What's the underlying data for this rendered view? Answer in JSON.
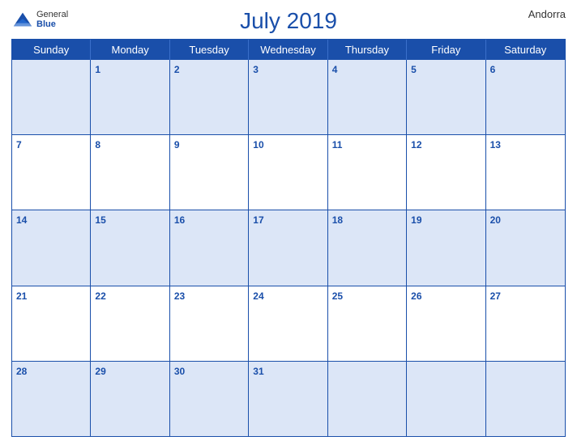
{
  "header": {
    "title": "July 2019",
    "country": "Andorra",
    "logo": {
      "general": "General",
      "blue": "Blue"
    }
  },
  "dayHeaders": [
    "Sunday",
    "Monday",
    "Tuesday",
    "Wednesday",
    "Thursday",
    "Friday",
    "Saturday"
  ],
  "weeks": [
    [
      {
        "num": "",
        "empty": true
      },
      {
        "num": "1"
      },
      {
        "num": "2"
      },
      {
        "num": "3"
      },
      {
        "num": "4"
      },
      {
        "num": "5"
      },
      {
        "num": "6"
      }
    ],
    [
      {
        "num": "7"
      },
      {
        "num": "8"
      },
      {
        "num": "9"
      },
      {
        "num": "10"
      },
      {
        "num": "11"
      },
      {
        "num": "12"
      },
      {
        "num": "13"
      }
    ],
    [
      {
        "num": "14"
      },
      {
        "num": "15"
      },
      {
        "num": "16"
      },
      {
        "num": "17"
      },
      {
        "num": "18"
      },
      {
        "num": "19"
      },
      {
        "num": "20"
      }
    ],
    [
      {
        "num": "21"
      },
      {
        "num": "22"
      },
      {
        "num": "23"
      },
      {
        "num": "24"
      },
      {
        "num": "25"
      },
      {
        "num": "26"
      },
      {
        "num": "27"
      }
    ],
    [
      {
        "num": "28"
      },
      {
        "num": "29"
      },
      {
        "num": "30"
      },
      {
        "num": "31"
      },
      {
        "num": "",
        "empty": true
      },
      {
        "num": "",
        "empty": true
      },
      {
        "num": "",
        "empty": true
      }
    ]
  ]
}
